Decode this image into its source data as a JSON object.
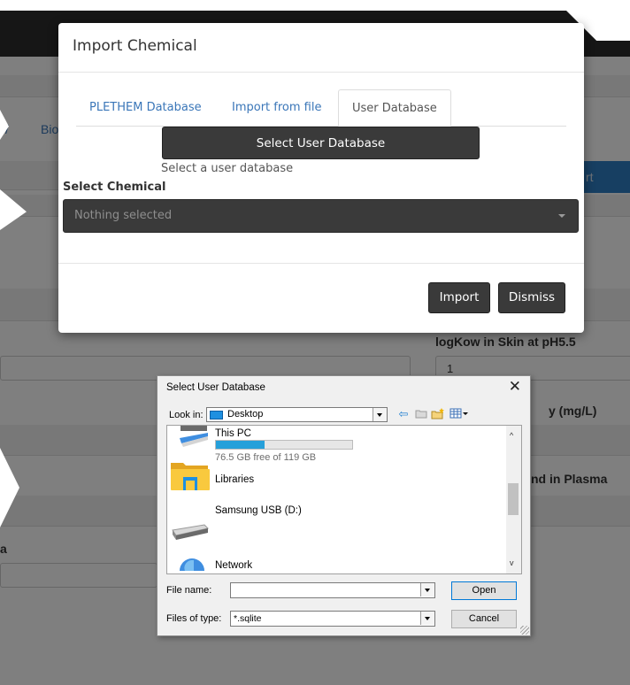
{
  "background": {
    "tab_fragments": [
      "/",
      "Bio"
    ],
    "blue_button_fragment": "rt",
    "right_labels": [
      "logKow in Skin at pH5.5",
      "y (mg/L)",
      "nd in Plasma"
    ],
    "right_value": "1",
    "right_fragment_paren": ")",
    "left_fragment": "a"
  },
  "modal": {
    "title": "Import Chemical",
    "tabs": [
      {
        "label": "PLETHEM Database",
        "active": false
      },
      {
        "label": "Import from file",
        "active": false
      },
      {
        "label": "User Database",
        "active": true
      }
    ],
    "select_db_button": "Select User Database",
    "select_db_help": "Select a user database",
    "select_chemical_label": "Select Chemical",
    "select_chemical_placeholder": "Nothing selected",
    "import_button": "Import",
    "dismiss_button": "Dismiss"
  },
  "file_dialog": {
    "title": "Select User Database",
    "close_glyph": "✕",
    "look_in_label": "Look in:",
    "look_in_value": "Desktop",
    "items": [
      {
        "label": "This PC",
        "icon": "computer-icon"
      },
      {
        "label": "Libraries",
        "icon": "libraries-folder-icon"
      },
      {
        "label": "Samsung USB (D:)",
        "icon": "usb-drive-icon",
        "free_text": "76.5 GB free of 119 GB",
        "used_fraction": 0.357
      },
      {
        "label": "Network",
        "icon": "network-icon"
      }
    ],
    "file_name_label": "File name:",
    "file_name_value": "",
    "file_type_label": "Files of type:",
    "file_type_value": "*.sqlite",
    "open_button": "Open",
    "cancel_button": "Cancel"
  }
}
